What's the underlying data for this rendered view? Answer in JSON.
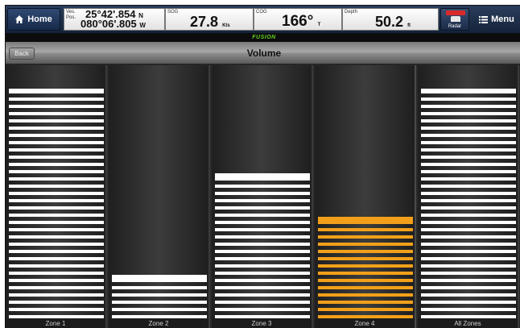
{
  "databar": {
    "home_label": "Home",
    "pos_label": "Ves.\nPos.",
    "lat": "25°42'.854",
    "lat_hemi": "N",
    "lon": "080°06'.805",
    "lon_hemi": "W",
    "sog_label": "SOG",
    "sog_value": "27.8",
    "sog_unit": "Kts",
    "cog_label": "COG",
    "cog_value": "166°",
    "cog_unit": "T",
    "depth_label": "Depth",
    "depth_value": "50.2",
    "depth_unit": "ft",
    "radar_label": "Radar",
    "menu_label": "Menu"
  },
  "brand": "FUSION",
  "header": {
    "back_label": "Back",
    "title": "Volume"
  },
  "zones": [
    {
      "label": "Zone 1",
      "level": 0.95,
      "selected": false
    },
    {
      "label": "Zone 2",
      "level": 0.18,
      "selected": false
    },
    {
      "label": "Zone 3",
      "level": 0.6,
      "selected": false
    },
    {
      "label": "Zone 4",
      "level": 0.42,
      "selected": true
    },
    {
      "label": "All Zones",
      "level": 0.95,
      "selected": false
    }
  ],
  "colors": {
    "selected": "#f2a01a",
    "bar": "#ffffff"
  }
}
